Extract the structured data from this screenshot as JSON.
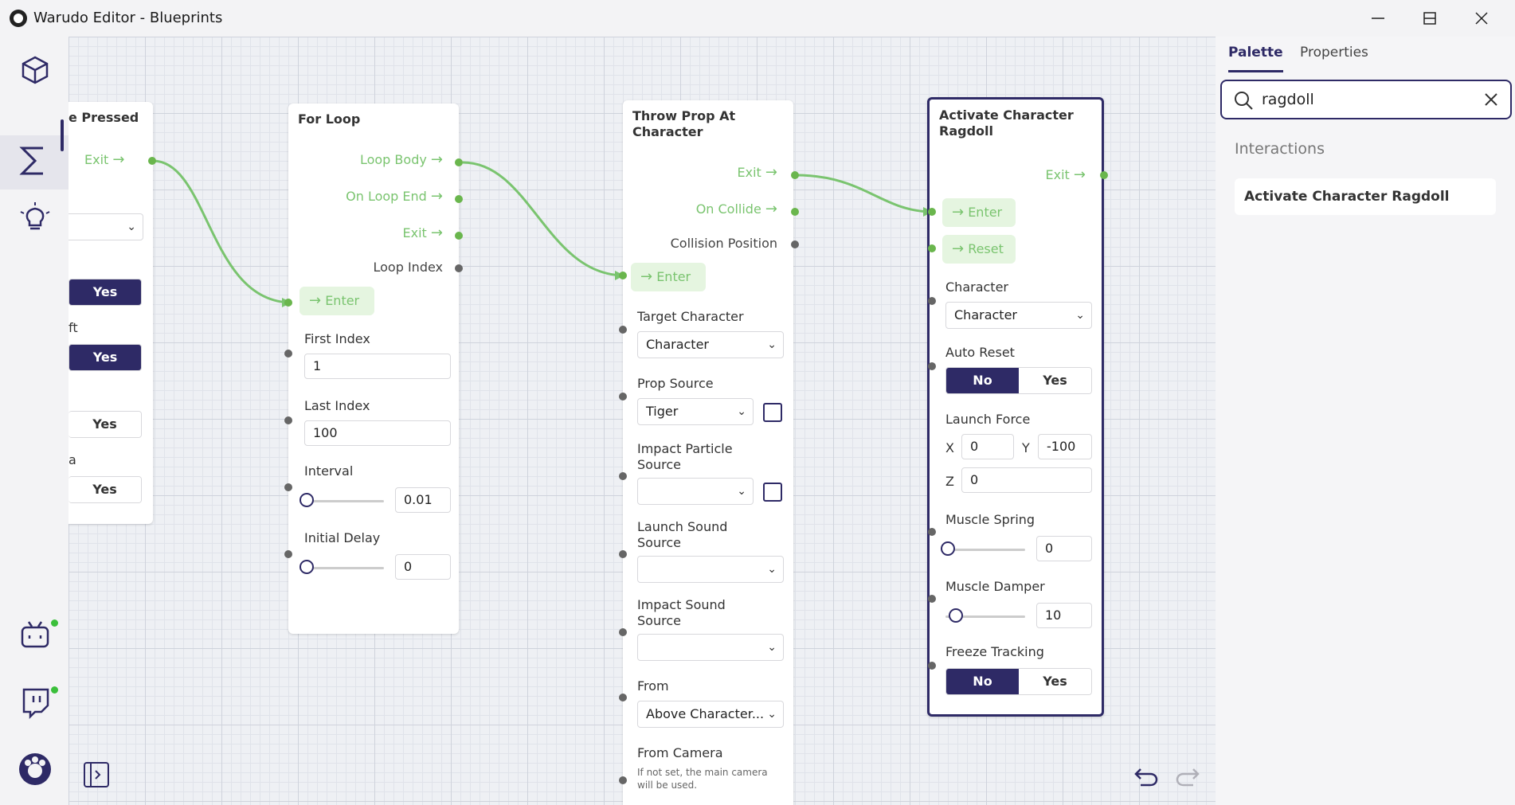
{
  "window": {
    "title": "Warudo Editor - Blueprints",
    "minimize": "—",
    "maximize": "☐",
    "close": "✕"
  },
  "colors": {
    "accent": "#2e2a66",
    "flow": "#7ac46f",
    "status": "#3bbf3b"
  },
  "sidebar": {
    "items": [
      {
        "icon": "cube-icon"
      },
      {
        "icon": "sigma-icon",
        "active": true
      },
      {
        "icon": "lightbulb-icon"
      },
      {
        "icon": "bilibili-icon",
        "status": "online"
      },
      {
        "icon": "twitch-icon",
        "status": "online"
      },
      {
        "icon": "warudo-logo-icon"
      },
      {
        "icon": "expand-panel-icon"
      }
    ]
  },
  "nodes": {
    "key_pressed": {
      "title": "e Pressed",
      "exit": "Exit",
      "yes1": "Yes",
      "yes2": "Yes",
      "yes3": "Yes",
      "yes4": "Yes",
      "frag1": "ft",
      "frag2": "a"
    },
    "for_loop": {
      "title": "For Loop",
      "loop_body": "Loop Body",
      "on_loop_end": "On Loop End",
      "exit": "Exit",
      "loop_index": "Loop Index",
      "enter": "Enter",
      "first_index_label": "First Index",
      "first_index": "1",
      "last_index_label": "Last Index",
      "last_index": "100",
      "interval_label": "Interval",
      "interval": "0.01",
      "initial_delay_label": "Initial Delay",
      "initial_delay": "0"
    },
    "throw_prop": {
      "title1": "Throw Prop At",
      "title2": "Character",
      "exit": "Exit",
      "on_collide": "On Collide",
      "collision_position": "Collision Position",
      "enter": "Enter",
      "target_character_label": "Target Character",
      "target_character": "Character",
      "prop_source_label": "Prop Source",
      "prop_source": "Tiger",
      "impact_particle_label1": "Impact Particle",
      "impact_particle_label2": "Source",
      "impact_particle": "",
      "launch_sound_label1": "Launch Sound",
      "launch_sound_label2": "Source",
      "launch_sound": "",
      "impact_sound_label1": "Impact Sound",
      "impact_sound_label2": "Source",
      "impact_sound": "",
      "from_label": "From",
      "from": "Above Character...",
      "from_camera_label": "From Camera",
      "hint1": "If not set, the main camera",
      "hint2": "will be used."
    },
    "ragdoll": {
      "title1": "Activate Character",
      "title2": "Ragdoll",
      "exit": "Exit",
      "enter": "Enter",
      "reset": "Reset",
      "character_label": "Character",
      "character": "Character",
      "auto_reset_label": "Auto Reset",
      "no": "No",
      "yes": "Yes",
      "launch_force_label": "Launch Force",
      "x_label": "X",
      "x": "0",
      "y_label": "Y",
      "y": "-100",
      "z_label": "Z",
      "z": "0",
      "muscle_spring_label": "Muscle Spring",
      "muscle_spring": "0",
      "muscle_damper_label": "Muscle Damper",
      "muscle_damper": "10",
      "freeze_tracking_label": "Freeze Tracking"
    }
  },
  "right_panel": {
    "tab_palette": "Palette",
    "tab_properties": "Properties",
    "search_value": "ragdoll",
    "section": "Interactions",
    "result": "Activate Character Ragdoll"
  }
}
